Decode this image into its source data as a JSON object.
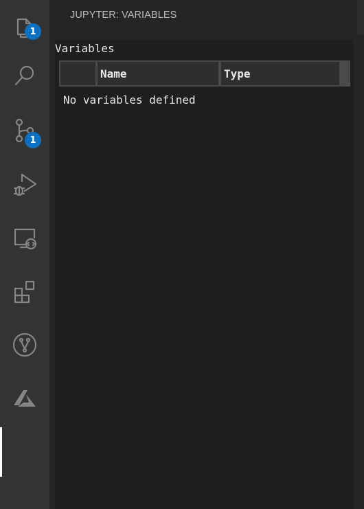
{
  "activity_bar": {
    "items": [
      {
        "name": "explorer",
        "icon": "files-icon",
        "badge": "1"
      },
      {
        "name": "search",
        "icon": "search-icon"
      },
      {
        "name": "source-control",
        "icon": "source-control-icon",
        "badge": "1"
      },
      {
        "name": "run-debug",
        "icon": "run-debug-icon"
      },
      {
        "name": "remote-explorer",
        "icon": "remote-explorer-icon"
      },
      {
        "name": "extensions",
        "icon": "extensions-icon"
      },
      {
        "name": "git-graph",
        "icon": "git-graph-icon"
      },
      {
        "name": "azure",
        "icon": "azure-icon"
      }
    ],
    "badge_color": "#0e70c0"
  },
  "panel": {
    "header": "JUPYTER: VARIABLES",
    "title": "Variables",
    "columns": [
      "",
      "Name",
      "Type"
    ],
    "empty_message": "No variables defined"
  },
  "colors": {
    "activity_bar_bg": "#333333",
    "panel_bg": "#1e1e1e",
    "sidebar_bg": "#252526",
    "text": "#e8e8e8"
  }
}
